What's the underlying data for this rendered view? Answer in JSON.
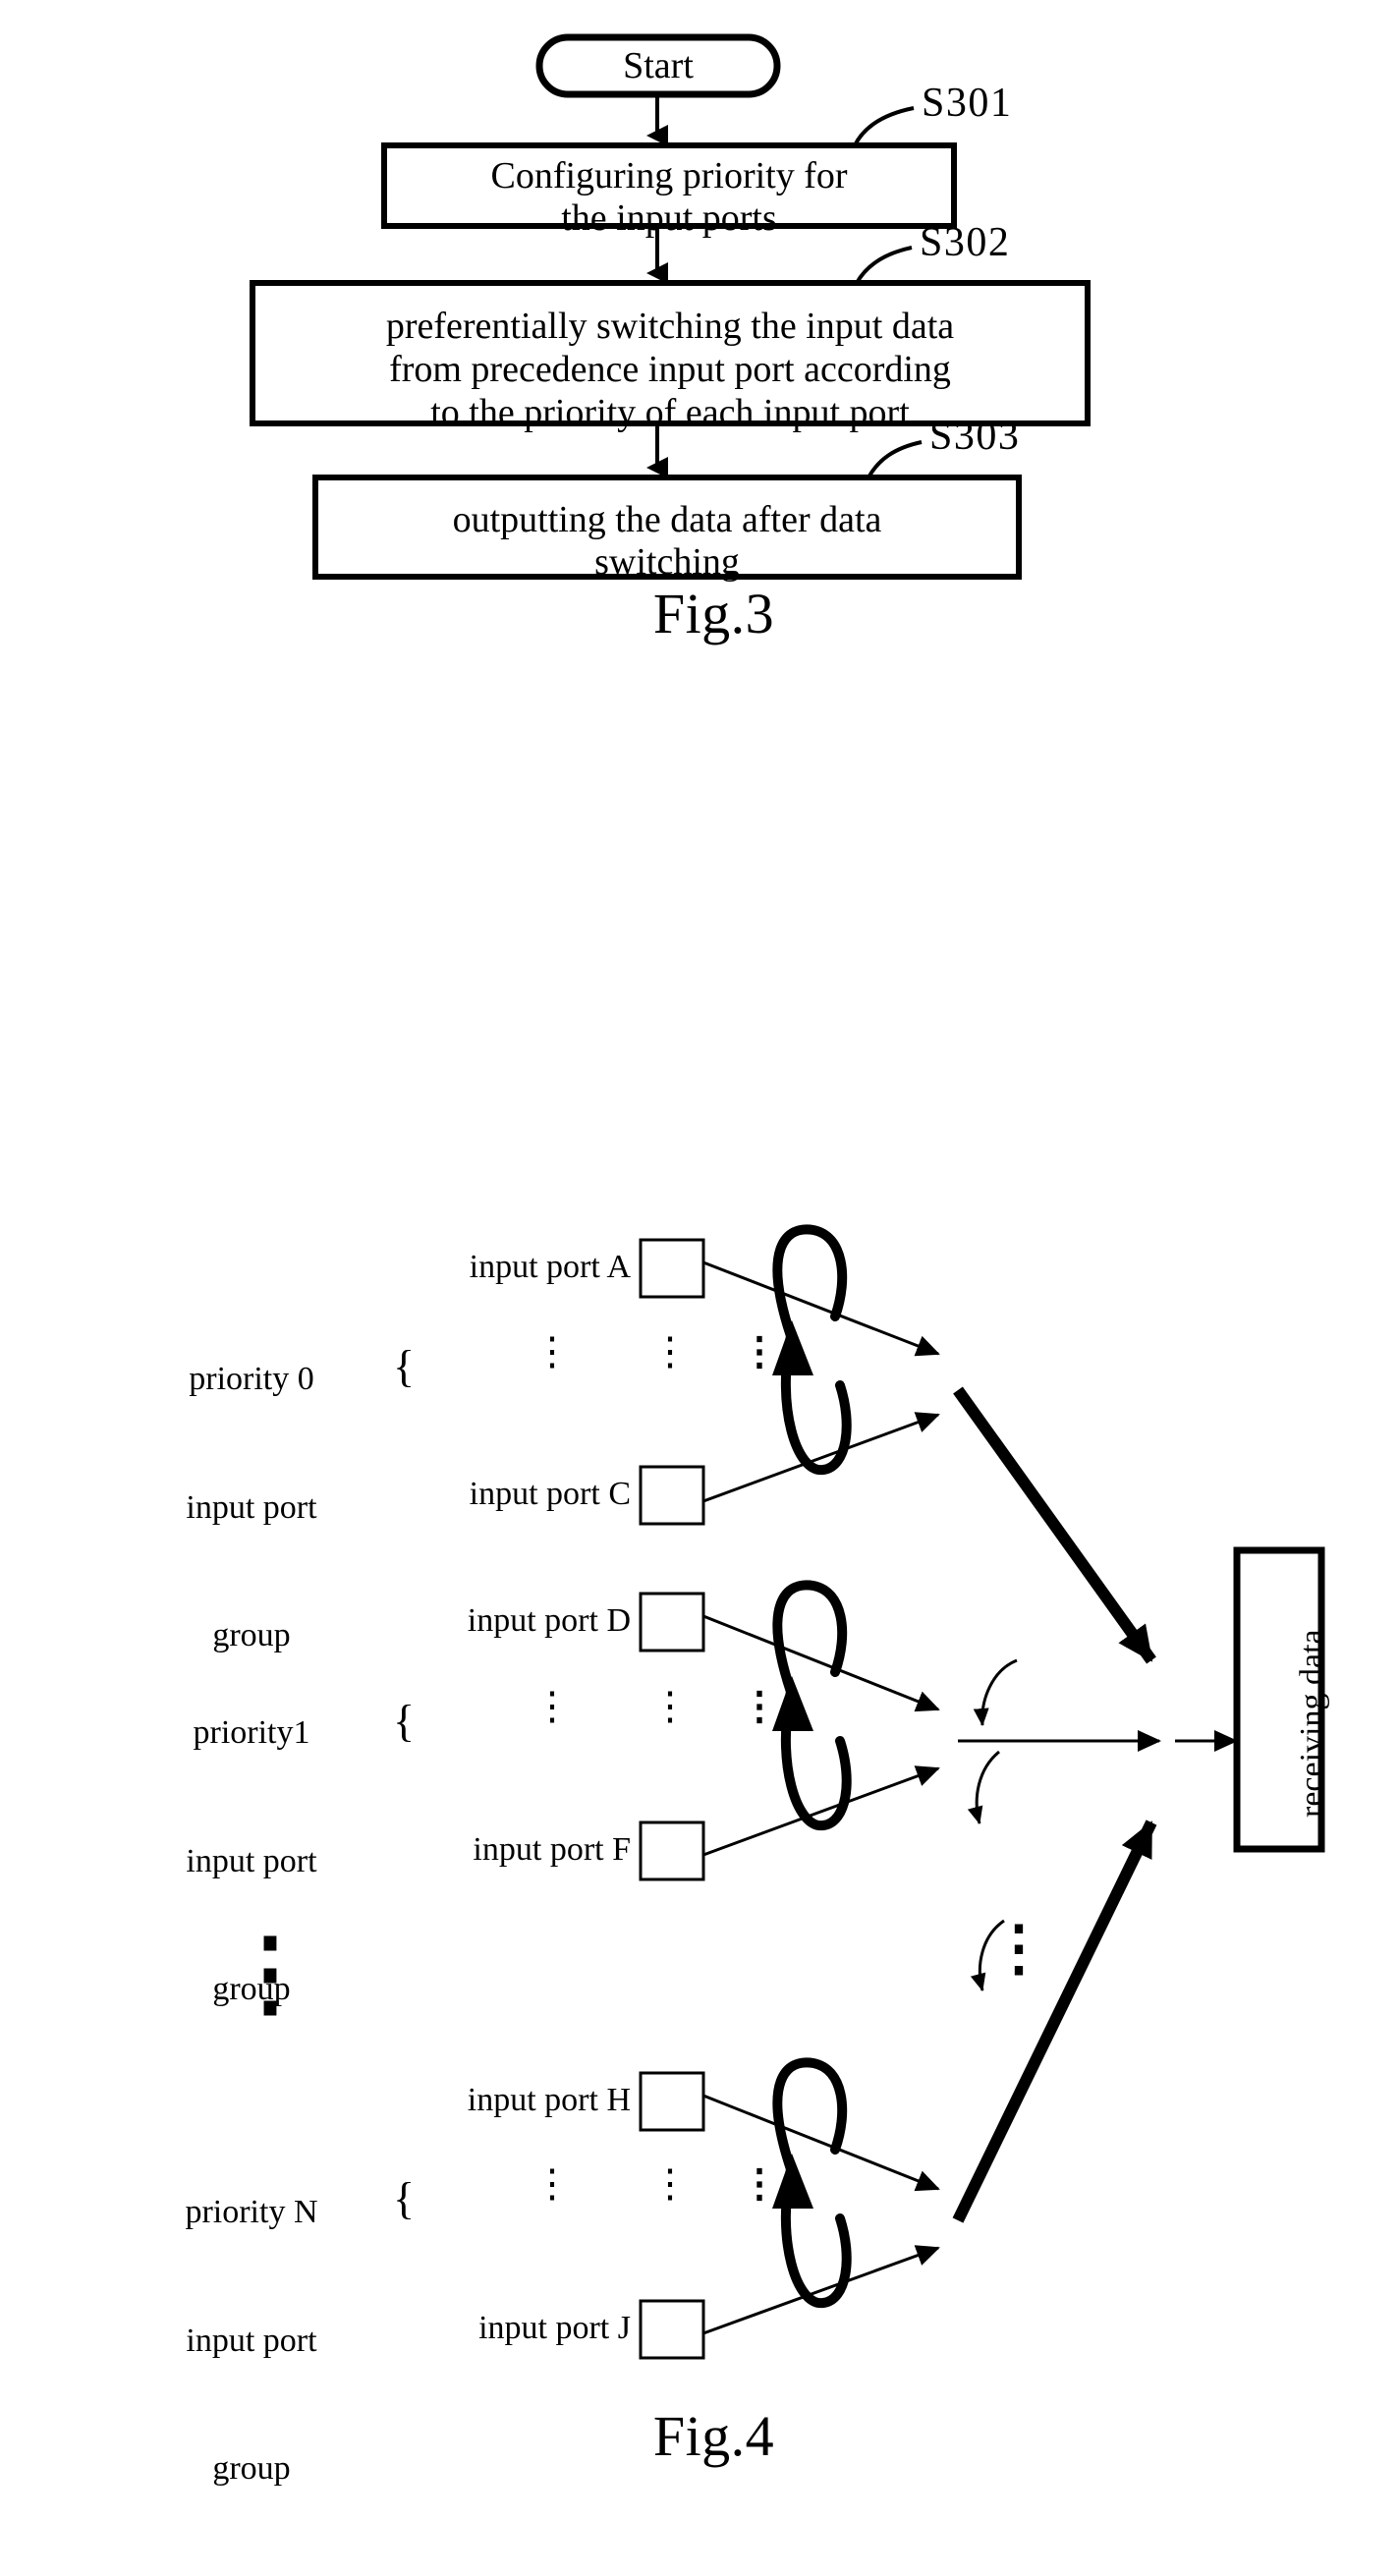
{
  "figure3": {
    "caption": "Fig.3",
    "start_node": {
      "label": "Start"
    },
    "steps": [
      {
        "ref": "S301",
        "lines": [
          "Configuring priority for",
          "the input ports"
        ]
      },
      {
        "ref": "S302",
        "lines": [
          "preferentially switching the input data",
          "from precedence input port according",
          "to the priority of each input port"
        ]
      },
      {
        "ref": "S303",
        "lines": [
          "outputting the data after data",
          "switching"
        ]
      }
    ]
  },
  "figure4": {
    "caption": "Fig.4",
    "output_node": {
      "label": "receiving data"
    },
    "vertical_ellipsis": "⋮",
    "brace": "{",
    "groups": [
      {
        "group_label_lines": [
          "priority 0",
          "input port",
          "group"
        ],
        "ports": [
          {
            "label": "input port A"
          },
          {
            "label": "input port C"
          }
        ]
      },
      {
        "group_label_lines": [
          "priority1",
          "input port",
          "group"
        ],
        "ports": [
          {
            "label": "input port D"
          },
          {
            "label": "input port F"
          }
        ]
      },
      {
        "group_label_lines": [
          "priority N",
          "input port",
          "group"
        ],
        "ports": [
          {
            "label": "input port H"
          },
          {
            "label": "input port J"
          }
        ]
      }
    ]
  },
  "colors": {
    "ink": "#000000",
    "paper": "#ffffff"
  }
}
